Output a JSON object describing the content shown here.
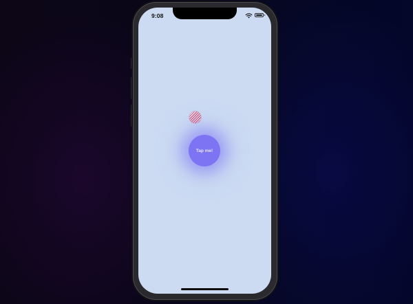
{
  "status_bar": {
    "time": "9:08",
    "wifi_icon": "wifi-icon",
    "battery_icon": "battery-icon"
  },
  "screen": {
    "background_color": "#ccdbf2",
    "pattern_ball_icon": "patterned-ball-icon",
    "tap_button": {
      "label": "Tap me!",
      "color": "#7c74f2"
    }
  }
}
